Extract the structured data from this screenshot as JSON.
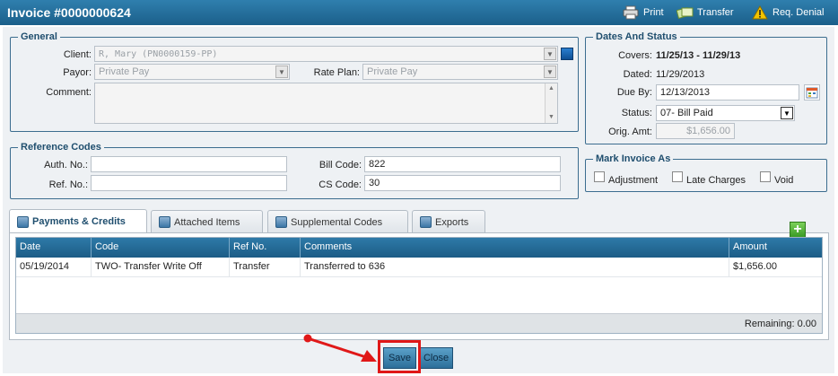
{
  "window": {
    "title": "Invoice #0000000624",
    "actions": {
      "print": "Print",
      "transfer": "Transfer",
      "req_denial": "Req. Denial"
    }
  },
  "general": {
    "legend": "General",
    "client_label": "Client:",
    "client_value": "R, Mary (PN0000159-PP)",
    "payor_label": "Payor:",
    "payor_value": "Private Pay",
    "rate_plan_label": "Rate Plan:",
    "rate_plan_value": "Private Pay",
    "comment_label": "Comment:",
    "comment_value": ""
  },
  "reference": {
    "legend": "Reference Codes",
    "auth_label": "Auth. No.:",
    "auth_value": "",
    "ref_label": "Ref. No.:",
    "ref_value": "",
    "bill_code_label": "Bill Code:",
    "bill_code_value": "822",
    "cs_code_label": "CS Code:",
    "cs_code_value": "30"
  },
  "dates": {
    "legend": "Dates And Status",
    "covers_label": "Covers:",
    "covers_value": "11/25/13 - 11/29/13",
    "dated_label": "Dated:",
    "dated_value": "11/29/2013",
    "due_label": "Due By:",
    "due_value": "12/13/2013",
    "status_label": "Status:",
    "status_value": "07- Bill Paid",
    "orig_label": "Orig. Amt:",
    "orig_value": "$1,656.00"
  },
  "mark": {
    "legend": "Mark Invoice As",
    "adjustment": "Adjustment",
    "late_charges": "Late Charges",
    "void": "Void"
  },
  "tabs": [
    "Payments & Credits",
    "Attached Items",
    "Supplemental Codes",
    "Exports"
  ],
  "grid": {
    "columns": [
      "Date",
      "Code",
      "Ref No.",
      "Comments",
      "Amount"
    ],
    "rows": [
      [
        "05/19/2014",
        "TWO- Transfer Write Off",
        "Transfer",
        "Transferred to 636",
        "$1,656.00"
      ]
    ],
    "remaining": "Remaining: 0.00"
  },
  "buttons": {
    "save": "Save",
    "close": "Close"
  },
  "colors": {
    "titlebar": "#1f6a98",
    "accent": "#1f4e6e",
    "highlight": "#e01818"
  }
}
